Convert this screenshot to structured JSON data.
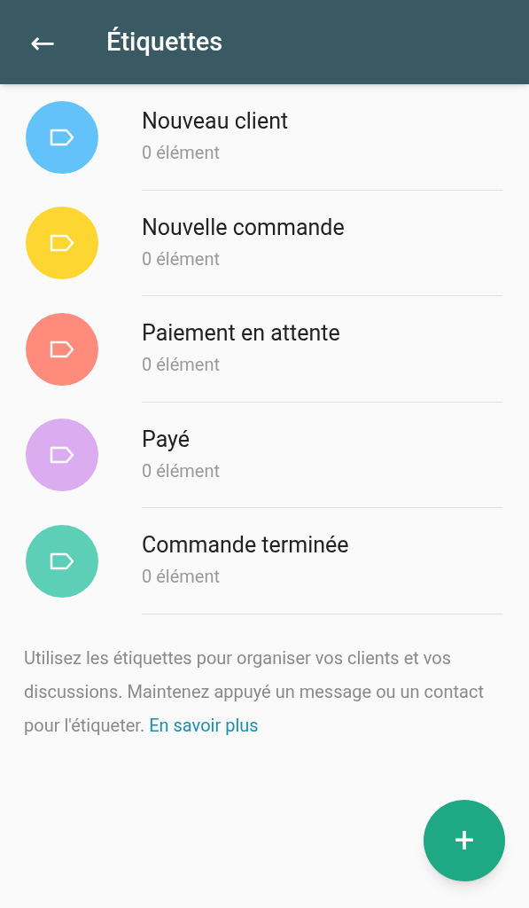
{
  "app_bar": {
    "back": "←",
    "title": "Étiquettes"
  },
  "labels": [
    {
      "name": "Nouveau client",
      "count": "0 élément",
      "color": "#64c2fb"
    },
    {
      "name": "Nouvelle commande",
      "count": "0 élément",
      "color": "#fdd631"
    },
    {
      "name": "Paiement en attente",
      "count": "0 élément",
      "color": "#fe8b7b"
    },
    {
      "name": "Payé",
      "count": "0 élément",
      "color": "#dcacf0"
    },
    {
      "name": "Commande terminée",
      "count": "0 élément",
      "color": "#5dcfb6"
    }
  ],
  "help": {
    "text": "Utilisez les étiquettes pour organiser vos clients et vos discussions. Maintenez appuyé un message ou un contact pour l'étiqueter.",
    "link": "En savoir plus"
  },
  "fab": {
    "label": "+"
  }
}
